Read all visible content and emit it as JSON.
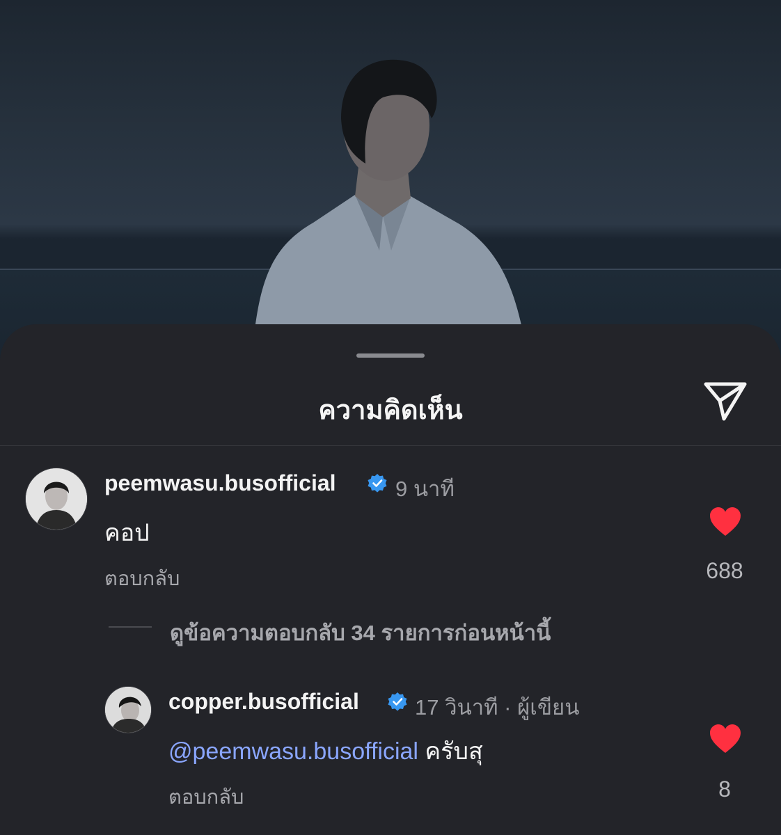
{
  "sheet": {
    "title": "ความคิดเห็น"
  },
  "comments": [
    {
      "username": "peemwasu.busofficial",
      "time": "9 นาที",
      "text": "คอป",
      "reply_label": "ตอบกลับ",
      "likes": "688",
      "liked": true
    },
    {
      "username": "copper.busofficial",
      "time": "17 วินาที · ผู้เขียน",
      "mention": "@peemwasu.busofficial",
      "text": "ครับสุ",
      "reply_label": "ตอบกลับ",
      "likes": "8",
      "liked": true
    }
  ],
  "thread": {
    "view_previous_replies": "ดูข้อความตอบกลับ 34 รายการก่อนหน้านี้"
  },
  "colors": {
    "sheet_bg": "#232429",
    "heart": "#ff3040",
    "verified": "#3897f0",
    "mention": "#8aa6ff"
  },
  "icons": [
    "send-icon",
    "verified-badge-icon",
    "heart-icon"
  ]
}
